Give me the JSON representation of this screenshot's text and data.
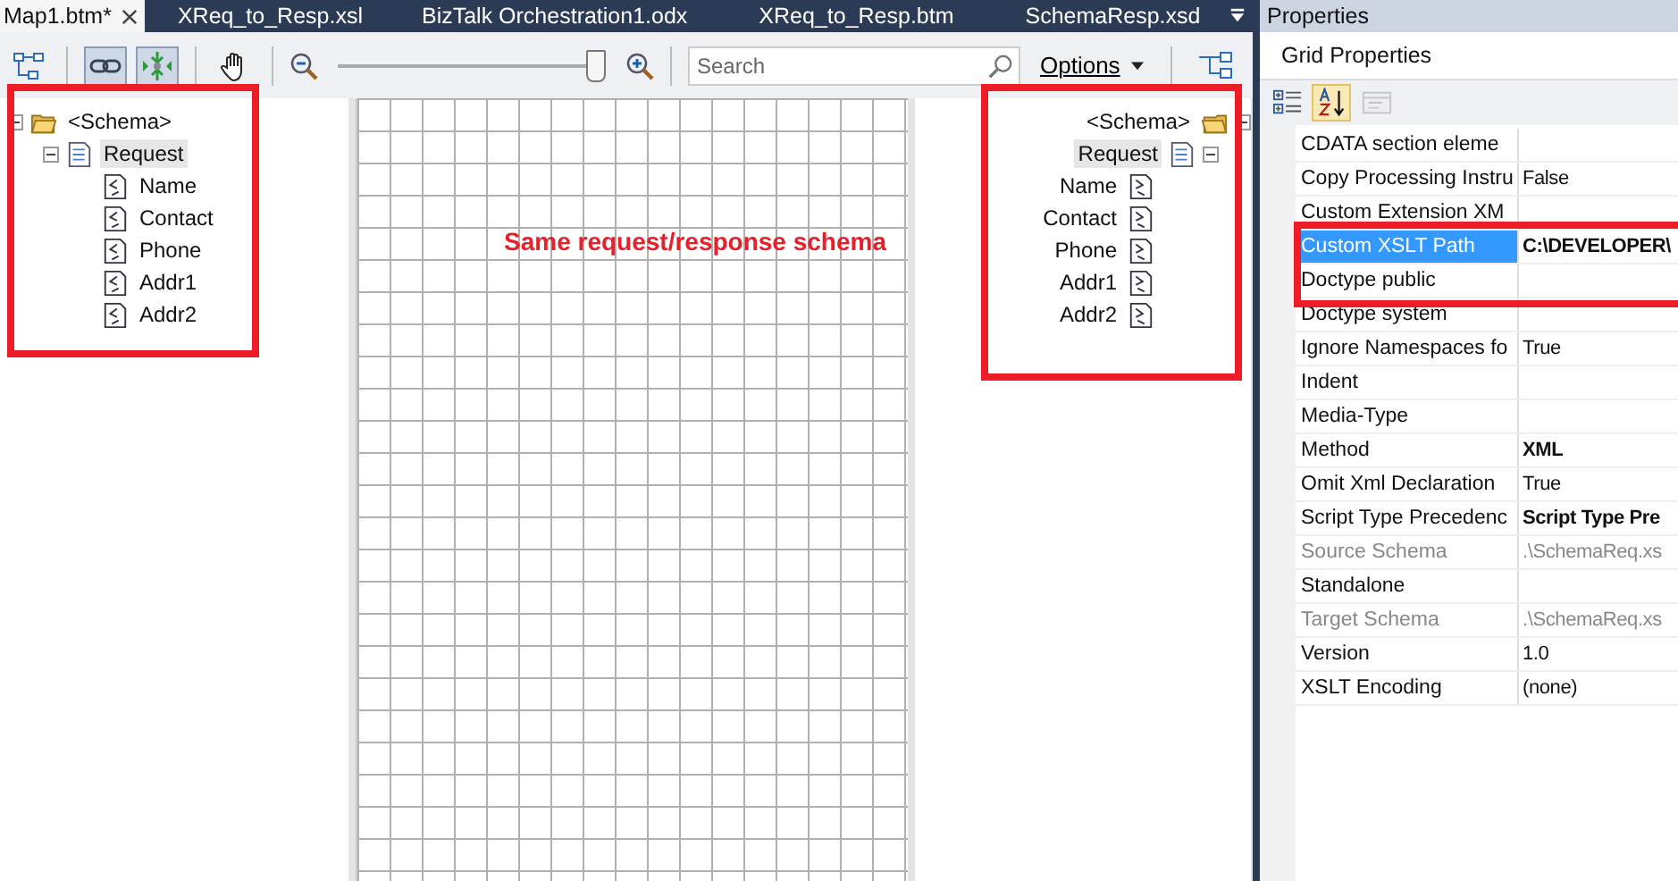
{
  "tabs": [
    {
      "label": "Map1.btm*",
      "selected": true
    },
    {
      "label": "XReq_to_Resp.xsl",
      "selected": false
    },
    {
      "label": "BizTalk Orchestration1.odx",
      "selected": false
    },
    {
      "label": "XReq_to_Resp.btm",
      "selected": false
    },
    {
      "label": "SchemaResp.xsd",
      "selected": false
    }
  ],
  "toolbar": {
    "buttons": [
      {
        "kind": "grid",
        "pressed": false
      },
      {
        "kind": "link",
        "pressed": true
      },
      {
        "kind": "expand",
        "pressed": true
      },
      {
        "kind": "hand",
        "pressed": false
      }
    ],
    "zoom": {
      "level": 0.96
    },
    "search": {
      "placeholder": "Search"
    },
    "options": "Options"
  },
  "source_schema": {
    "label": "<Schema>",
    "expanded": true,
    "children": [
      {
        "label": "Request",
        "selected": true,
        "expanded": true,
        "children": [
          {
            "label": "Name"
          },
          {
            "label": "Contact"
          },
          {
            "label": "Phone"
          },
          {
            "label": "Addr1"
          },
          {
            "label": "Addr2"
          }
        ]
      }
    ]
  },
  "destination_schema": {
    "label": "<Schema>",
    "expanded": true,
    "children": [
      {
        "label": "Request",
        "selected": true,
        "expanded": true,
        "children": [
          {
            "label": "Name"
          },
          {
            "label": "Contact"
          },
          {
            "label": "Phone"
          },
          {
            "label": "Addr1"
          },
          {
            "label": "Addr2"
          }
        ]
      }
    ]
  },
  "annotation": "Same request/response schema",
  "properties": {
    "title": "Properties",
    "object": "Grid Properties",
    "sort_buttons": [
      {
        "kind": "categorized",
        "pressed": false,
        "disabled": false
      },
      {
        "kind": "alphabetical",
        "pressed": true,
        "disabled": false
      },
      {
        "kind": "pages",
        "pressed": false,
        "disabled": true
      }
    ],
    "rows": [
      {
        "name": "CDATA section eleme",
        "value": "",
        "selected": false,
        "disabled": false
      },
      {
        "name": "Copy Processing Instru",
        "value": "False",
        "selected": false,
        "disabled": false,
        "bold": false
      },
      {
        "name": "Custom Extension XM",
        "value": "",
        "selected": false,
        "disabled": false
      },
      {
        "name": "Custom XSLT Path",
        "value": "C:\\DEVELOPER\\",
        "selected": true,
        "disabled": false,
        "bold": true
      },
      {
        "name": "Doctype public",
        "value": "",
        "selected": false,
        "disabled": false
      },
      {
        "name": "Doctype system",
        "value": "",
        "selected": false,
        "disabled": false
      },
      {
        "name": "Ignore Namespaces fo",
        "value": "True",
        "selected": false,
        "disabled": false,
        "bold": false
      },
      {
        "name": "Indent",
        "value": "",
        "selected": false,
        "disabled": false
      },
      {
        "name": "Media-Type",
        "value": "",
        "selected": false,
        "disabled": false
      },
      {
        "name": "Method",
        "value": "XML",
        "selected": false,
        "disabled": false,
        "bold": true
      },
      {
        "name": "Omit Xml Declaration",
        "value": "True",
        "selected": false,
        "disabled": false,
        "bold": false
      },
      {
        "name": "Script Type Precedenc",
        "value": "Script Type Pre",
        "selected": false,
        "disabled": false,
        "bold": true
      },
      {
        "name": "Source Schema",
        "value": ".\\SchemaReq.xs",
        "selected": false,
        "disabled": true,
        "bold": false
      },
      {
        "name": "Standalone",
        "value": "",
        "selected": false,
        "disabled": false
      },
      {
        "name": "Target Schema",
        "value": ".\\SchemaReq.xs",
        "selected": false,
        "disabled": true,
        "bold": false
      },
      {
        "name": "Version",
        "value": "1.0",
        "selected": false,
        "disabled": false,
        "bold": false
      },
      {
        "name": "XSLT Encoding",
        "value": "(none)",
        "selected": false,
        "disabled": false,
        "bold": false
      }
    ]
  }
}
